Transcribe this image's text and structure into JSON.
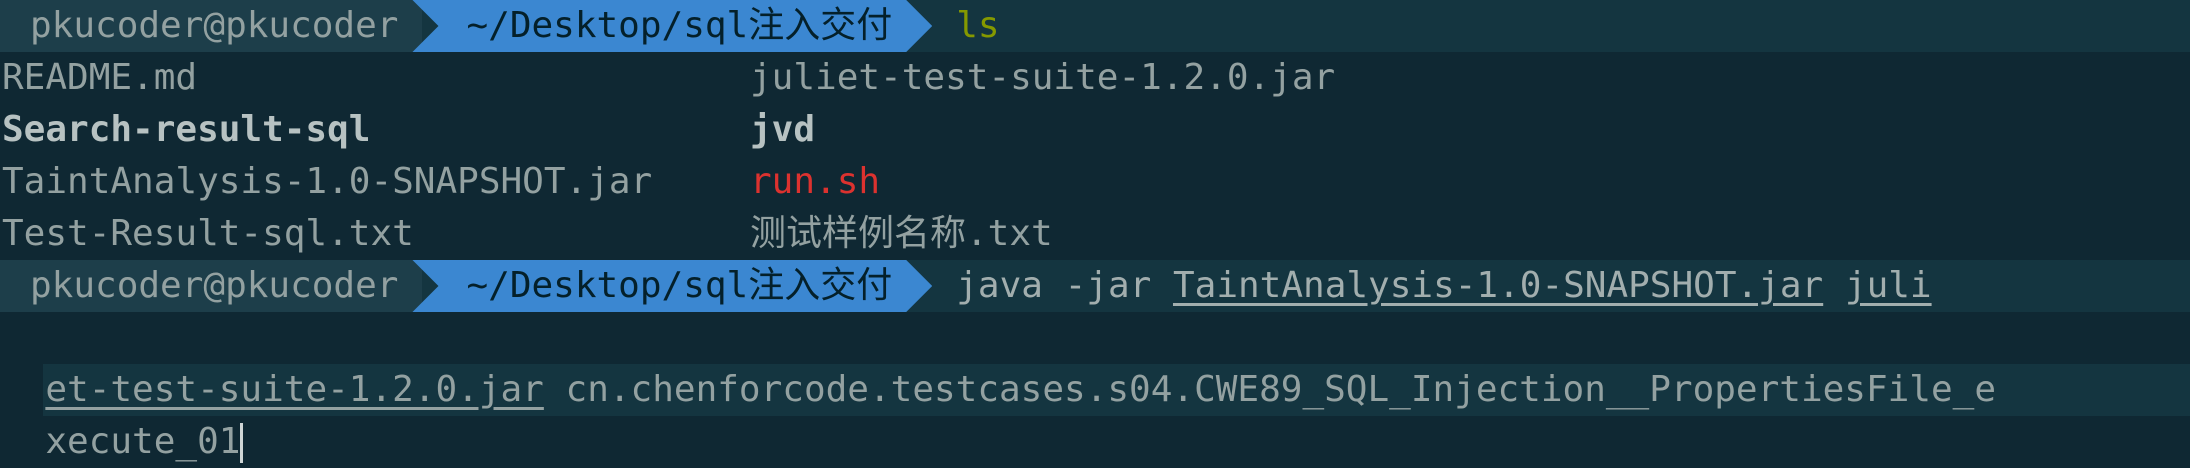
{
  "prompt1": {
    "user_host": "pkucoder@pkucoder",
    "path": "~/Desktop/sql注入交付",
    "command": "ls"
  },
  "ls_output": [
    {
      "left": "README.md",
      "left_style": "normal",
      "right": "juliet-test-suite-1.2.0.jar",
      "right_style": "normal"
    },
    {
      "left": "Search-result-sql",
      "left_style": "bold",
      "right": "jvd",
      "right_style": "bold"
    },
    {
      "left": "TaintAnalysis-1.0-SNAPSHOT.jar",
      "left_style": "normal",
      "right": "run.sh",
      "right_style": "red"
    },
    {
      "left": "Test-Result-sql.txt",
      "left_style": "normal",
      "right": "测试样例名称.txt",
      "right_style": "normal"
    }
  ],
  "prompt2": {
    "user_host": "pkucoder@pkucoder",
    "path": "~/Desktop/sql注入交付",
    "cmd_java": "java -jar ",
    "arg1": "TaintAnalysis-1.0-SNAPSHOT.jar",
    "arg2_part1": "juli",
    "arg2_part2": "et-test-suite-1.2.0.jar",
    "arg3_part1": " cn.chenforcode.testcases.s04.CWE89_SQL_Injection__PropertiesFile_e",
    "arg3_part2": "xecute_01"
  },
  "colors": {
    "background": "#0f2833",
    "path_segment": "#3b87d1",
    "command_green": "#859900",
    "executable_red": "#dc322f"
  }
}
